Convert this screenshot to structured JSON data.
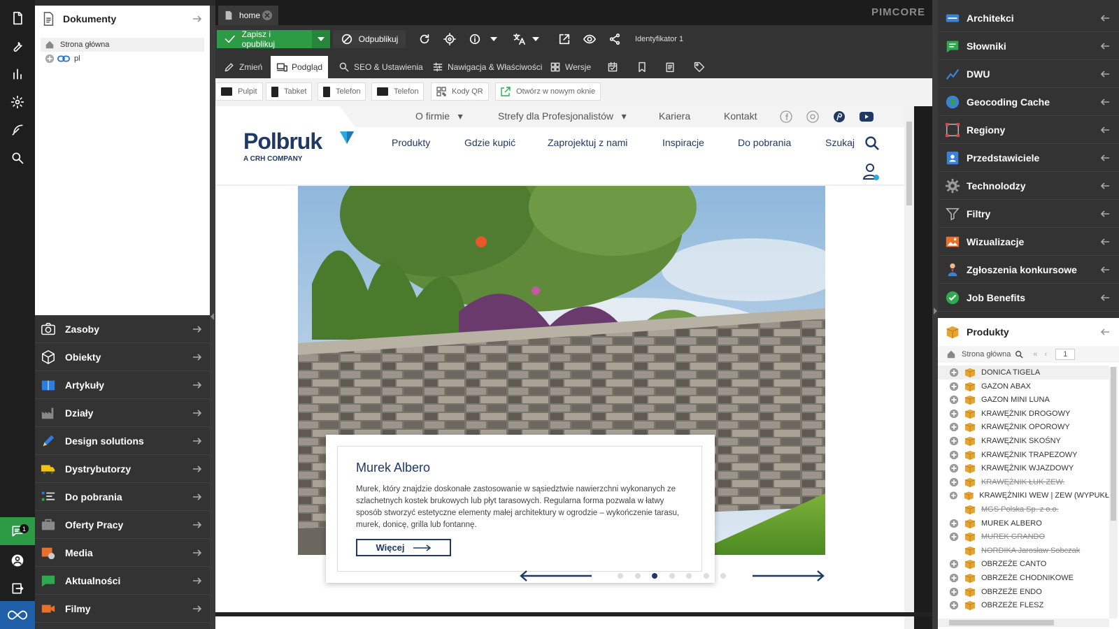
{
  "rail": {
    "icons": [
      "document-icon",
      "wrench-icon",
      "bar-chart-icon",
      "gear-icon",
      "feather-icon",
      "search-icon"
    ],
    "bottom_icons": [
      "chat-icon",
      "user-icon",
      "logout-icon",
      "infinity-icon"
    ],
    "chat_badge": "1"
  },
  "docs_panel": {
    "title": "Dokumenty",
    "tree": [
      {
        "label": "Strona główna",
        "icon": "home-icon"
      },
      {
        "label": "pl",
        "icon": "link-icon"
      }
    ]
  },
  "left_nav": [
    {
      "label": "Zasoby",
      "icon": "camera-icon"
    },
    {
      "label": "Obiekty",
      "icon": "cube-icon"
    },
    {
      "label": "Artykuły",
      "icon": "book-icon"
    },
    {
      "label": "Działy",
      "icon": "factory-icon"
    },
    {
      "label": "Design solutions",
      "icon": "pencil-icon"
    },
    {
      "label": "Dystrybutorzy",
      "icon": "truck-icon"
    },
    {
      "label": "Do pobrania",
      "icon": "list-icon"
    },
    {
      "label": "Oferty Pracy",
      "icon": "briefcase-icon"
    },
    {
      "label": "Media",
      "icon": "media-icon"
    },
    {
      "label": "Aktualności",
      "icon": "news-icon"
    },
    {
      "label": "Filmy",
      "icon": "video-icon"
    }
  ],
  "tab": {
    "label": "home"
  },
  "brand": "PIMCORE",
  "toolbar": {
    "save_label": "Zapisz i opublikuj",
    "unpublish_label": "Odpublikuj",
    "identifier": "Identyfikator 1"
  },
  "subtabs": [
    {
      "label": "Zmień"
    },
    {
      "label": "Podgląd"
    },
    {
      "label": "SEO & Ustawienia"
    },
    {
      "label": "Nawigacja & Właściwości"
    },
    {
      "label": "Wersje"
    }
  ],
  "devices": [
    {
      "label": "Pulpit"
    },
    {
      "label": "Tabket"
    },
    {
      "label": "Telefon"
    },
    {
      "label": "Telefon"
    },
    {
      "label": "Kody QR"
    },
    {
      "label": "Otwórz w nowym oknie"
    }
  ],
  "site": {
    "logo": "Polbruk",
    "logo_sub_a": "A ",
    "logo_sub_b": "CRH",
    "logo_sub_c": " COMPANY",
    "top_links": [
      "O firmie",
      "Strefy dla Profesjonalistów",
      "Kariera",
      "Kontakt"
    ],
    "main_links": [
      "Produkty",
      "Gdzie kupić",
      "Zaprojektuj z nami",
      "Inspiracje",
      "Do pobrania",
      "Szukaj"
    ],
    "card_title": "Murek Albero",
    "card_text": "Murek, który znajdzie doskonałe zastosowanie w sąsiedztwie nawierzchni wykonanych ze szlachetnych kostek brukowych lub płyt tarasowych. Regularna forma pozwala w łatwy sposób stworzyć estetyczne elementy małej architektury w ogrodzie – wykończenie tarasu, murek, donicę, grilla lub fontannę.",
    "more_label": "Więcej",
    "slider_active": 3,
    "slider_count": 7
  },
  "right_panel": [
    {
      "label": "Architekci",
      "icon": "architect-icon",
      "color": "#3b82d6"
    },
    {
      "label": "Słowniki",
      "icon": "dictionary-icon",
      "color": "#2fa84f"
    },
    {
      "label": "DWU",
      "icon": "chart-line-icon",
      "color": "#3b82d6"
    },
    {
      "label": "Geocoding Cache",
      "icon": "globe-icon",
      "color": "#3a9b4a"
    },
    {
      "label": "Regiony",
      "icon": "region-icon",
      "color": "#d04a4a"
    },
    {
      "label": "Przedstawiciele",
      "icon": "contact-icon",
      "color": "#3b82d6"
    },
    {
      "label": "Technolodzy",
      "icon": "cog-icon",
      "color": "#9a9a9a"
    },
    {
      "label": "Filtry",
      "icon": "filter-icon",
      "color": "#bbbbbb"
    },
    {
      "label": "Wizualizacje",
      "icon": "image-icon",
      "color": "#e8702a"
    },
    {
      "label": "Zgłoszenia konkursowe",
      "icon": "person-icon",
      "color": "#d04a4a"
    },
    {
      "label": "Job Benefits",
      "icon": "check-icon",
      "color": "#2fa84f"
    }
  ],
  "products": {
    "title": "Produkty",
    "home_label": "Strona główna",
    "page": "1",
    "items": [
      {
        "label": "DONICA TIGELA",
        "plus": true,
        "strike": false
      },
      {
        "label": "GAZON ABAX",
        "plus": true,
        "strike": false
      },
      {
        "label": "GAZON MINI LUNA",
        "plus": true,
        "strike": false
      },
      {
        "label": "KRAWĘŻNIK DROGOWY",
        "plus": true,
        "strike": false
      },
      {
        "label": "KRAWĘŻNIK OPOROWY",
        "plus": true,
        "strike": false
      },
      {
        "label": "KRAWĘŻNIK SKOŚNY",
        "plus": true,
        "strike": false
      },
      {
        "label": "KRAWĘŻNIK TRAPEZOWY",
        "plus": true,
        "strike": false
      },
      {
        "label": "KRAWĘŻNIK WJAZDOWY",
        "plus": true,
        "strike": false
      },
      {
        "label": "KRAWĘŻNIK ŁUK ZEW.",
        "plus": true,
        "strike": true
      },
      {
        "label": "KRAWĘŻNIKI WEW | ZEW (WYPUKŁ",
        "plus": true,
        "strike": false
      },
      {
        "label": "MGS Polska Sp. z o.o.",
        "plus": false,
        "strike": true
      },
      {
        "label": "MUREK ALBERO",
        "plus": true,
        "strike": false
      },
      {
        "label": "MUREK GRANDO",
        "plus": true,
        "strike": true
      },
      {
        "label": "NORDIKA Jarosław Sobczak",
        "plus": false,
        "strike": true
      },
      {
        "label": "OBRZEŻE CANTO",
        "plus": true,
        "strike": false
      },
      {
        "label": "OBRZEŻE CHODNIKOWE",
        "plus": true,
        "strike": false
      },
      {
        "label": "OBRZEŻE ENDO",
        "plus": true,
        "strike": false
      },
      {
        "label": "OBRZEŻE FLESZ",
        "plus": true,
        "strike": false
      }
    ]
  }
}
